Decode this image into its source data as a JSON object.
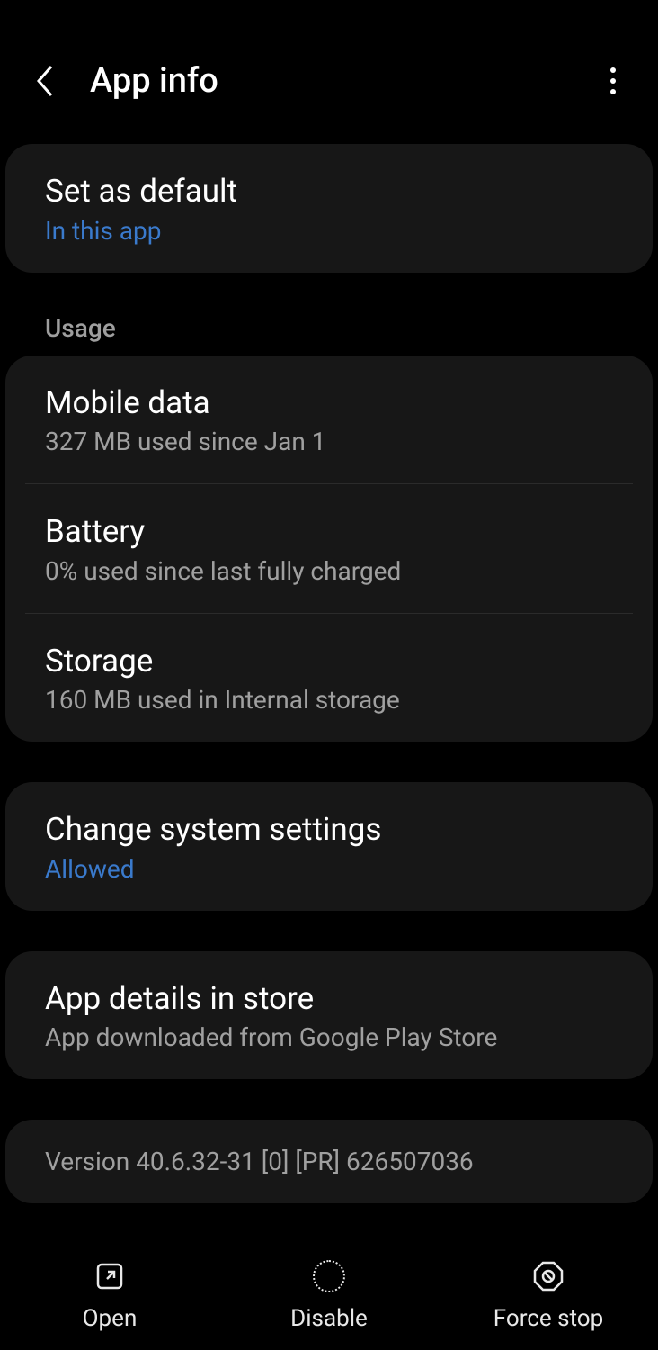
{
  "header": {
    "title": "App info"
  },
  "setDefault": {
    "title": "Set as default",
    "sub": "In this app"
  },
  "usage": {
    "header": "Usage",
    "items": [
      {
        "title": "Mobile data",
        "sub": "327 MB used since Jan 1"
      },
      {
        "title": "Battery",
        "sub": "0% used since last fully charged"
      },
      {
        "title": "Storage",
        "sub": "160 MB used in Internal storage"
      }
    ]
  },
  "changeSystem": {
    "title": "Change system settings",
    "sub": "Allowed"
  },
  "appDetails": {
    "title": "App details in store",
    "sub": "App downloaded from Google Play Store"
  },
  "version": "Version 40.6.32-31 [0] [PR] 626507036",
  "actions": {
    "open": "Open",
    "disable": "Disable",
    "forceStop": "Force stop"
  }
}
